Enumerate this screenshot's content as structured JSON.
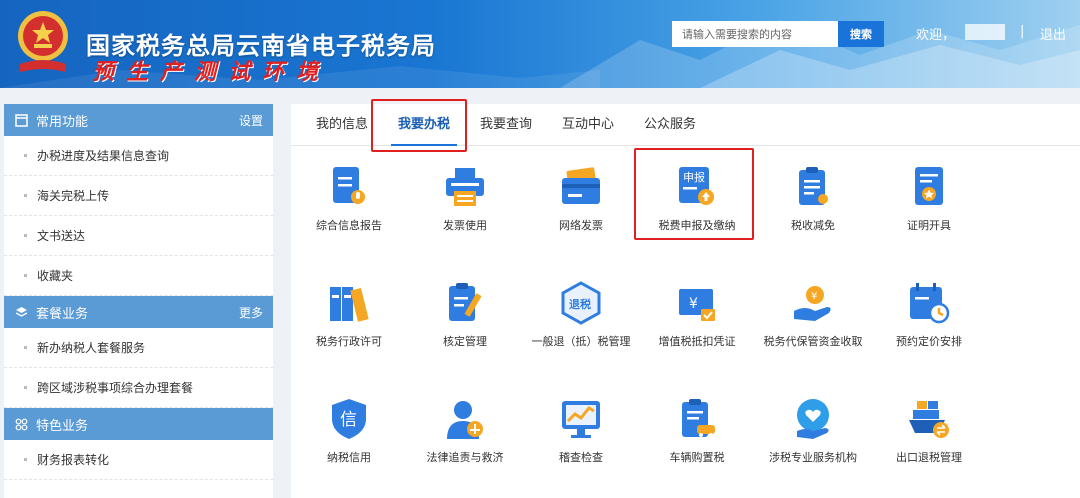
{
  "header": {
    "title": "国家税务总局云南省电子税务局",
    "subtitle": "预生产测试环境",
    "search_placeholder": "请输入需要搜索的内容",
    "search_button": "搜索",
    "welcome": "欢迎，",
    "separator": "|",
    "logout": "退出"
  },
  "sidebar": {
    "sections": [
      {
        "icon": "window-icon",
        "title": "常用功能",
        "link": "设置",
        "items": [
          "办税进度及结果信息查询",
          "海关完税上传",
          "文书送达",
          "收藏夹"
        ]
      },
      {
        "icon": "layers-icon",
        "title": "套餐业务",
        "link": "更多",
        "items": [
          "新办纳税人套餐服务",
          "跨区域涉税事项综合办理套餐"
        ]
      },
      {
        "icon": "grid-icon",
        "title": "特色业务",
        "link": "",
        "items": [
          "财务报表转化"
        ]
      }
    ]
  },
  "tabs": [
    "我的信息",
    "我要办税",
    "我要查询",
    "互动中心",
    "公众服务"
  ],
  "active_tab": 1,
  "tiles": [
    "综合信息报告",
    "发票使用",
    "网络发票",
    "税费申报及缴纳",
    "税收减免",
    "证明开具",
    "税务行政许可",
    "核定管理",
    "一般退（抵）税管理",
    "增值税抵扣凭证",
    "税务代保管资金收取",
    "预约定价安排",
    "纳税信用",
    "法律追责与救济",
    "稽查检查",
    "车辆购置税",
    "涉税专业服务机构",
    "出口退税管理"
  ],
  "tile_icon_text": {
    "shenbao": "申报",
    "tuishui": "退税",
    "xin": "信",
    "yen": "¥"
  },
  "colors": {
    "primary": "#1a73d9",
    "sidebar_head": "#5b9bd5",
    "highlight": "#e02020",
    "icon_orange": "#f5a623"
  }
}
